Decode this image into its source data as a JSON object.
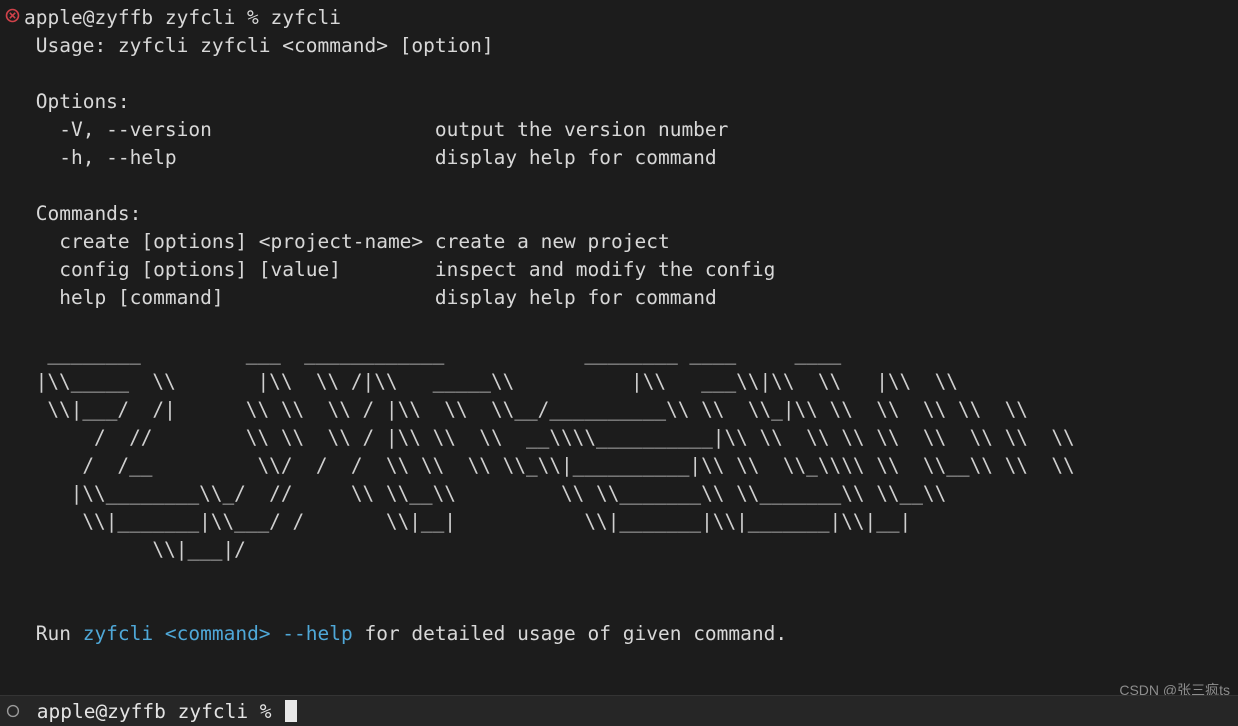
{
  "window": {
    "background_color": "#1c1c1c",
    "text_color": "#d8d8d8",
    "accent_color": "#4fa8d8",
    "error_color": "#d0424a"
  },
  "top_prompt": {
    "icon": "error-circle-icon",
    "text": "apple@zyffb zyfcli % zyfcli"
  },
  "output": {
    "usage_line": " Usage: zyfcli zyfcli <command> [option]",
    "options_heading": " Options:",
    "options": [
      {
        "flags": "   -V, --version",
        "pad": "                   ",
        "description": "output the version number"
      },
      {
        "flags": "   -h, --help",
        "pad": "                      ",
        "description": "display help for command"
      }
    ],
    "commands_heading": " Commands:",
    "commands": [
      {
        "signature": "   create [options] <project-name>",
        "pad": " ",
        "description": "create a new project"
      },
      {
        "signature": "   config [options] [value]",
        "pad": "        ",
        "description": "inspect and modify the config"
      },
      {
        "signature": "   help [command]",
        "pad": "                  ",
        "description": "display help for command"
      }
    ],
    "footer": {
      "prefix": " Run ",
      "highlight": "zyfcli <command> --help",
      "suffix": " for detailed usage of given command."
    }
  },
  "ascii_banner": {
    "name": "zyfcli-ascii-logo",
    "lines": [
      "  ________         ___  ____________            ________ ____     ____",
      " |\\\\_____  \\\\       |\\\\  \\\\ /|\\\\   _____\\\\          |\\\\   ___\\\\|\\\\  \\\\   |\\\\  \\\\",
      "  \\\\|___/  /|      \\\\ \\\\  \\\\ / |\\\\  \\\\  \\\\__/__________\\\\ \\\\  \\\\_|\\\\ \\\\  \\\\  \\\\ \\\\  \\\\",
      "      /  //        \\\\ \\\\  \\\\ / |\\\\ \\\\  \\\\  __\\\\\\\\__________|\\\\ \\\\  \\\\ \\\\ \\\\  \\\\  \\\\ \\\\  \\\\",
      "     /  /__         \\\\/  /  /  \\\\ \\\\  \\\\ \\\\_\\\\|__________|\\\\ \\\\  \\\\_\\\\\\\\ \\\\  \\\\__\\\\ \\\\  \\\\",
      "    |\\\\________\\\\_/  //     \\\\ \\\\__\\\\         \\\\ \\\\_______\\\\ \\\\_______\\\\ \\\\__\\\\",
      "     \\\\|_______|\\\\___/ /       \\\\|__|           \\\\|_______|\\\\|_______|\\\\|__|",
      "           \\\\|___|/"
    ]
  },
  "bottom_bar": {
    "icon": "idle-circle-icon",
    "prompt": " apple@zyffb zyfcli % ",
    "cursor": "block-cursor"
  },
  "watermark": {
    "text": "CSDN @张三疯ts"
  }
}
